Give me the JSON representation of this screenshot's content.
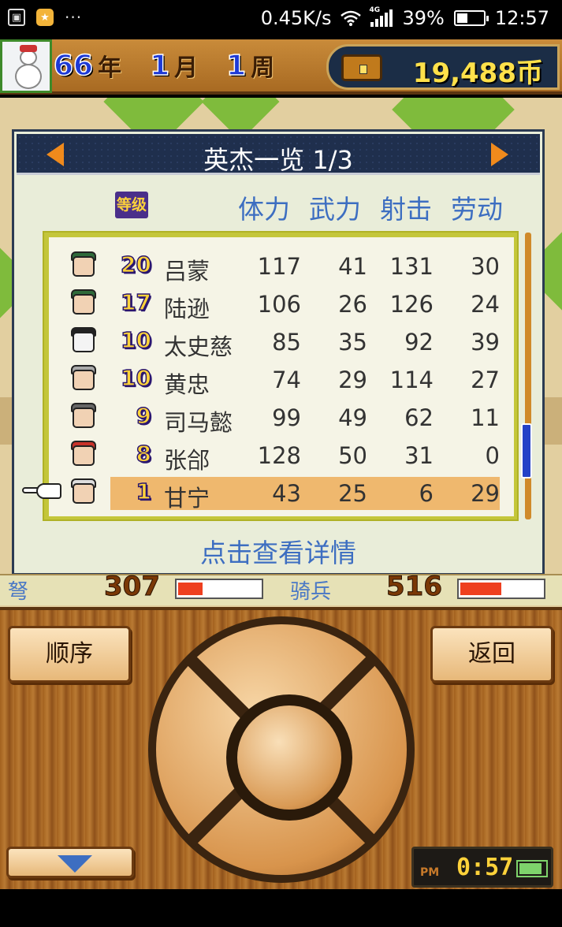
{
  "status_bar": {
    "network_speed": "0.45K/s",
    "network_type": "4G",
    "battery_percent": "39%",
    "time": "12:57",
    "icons": [
      "image-icon",
      "star-app-icon",
      "wifi-icon",
      "signal-icon",
      "battery-icon"
    ],
    "more": "···"
  },
  "game_header": {
    "year_num": "66",
    "year_unit": "年",
    "month_num": "1",
    "month_unit": "月",
    "week_num": "1",
    "week_unit": "周",
    "money": "19,488币"
  },
  "dialog": {
    "title": "英杰一览 1/3",
    "level_header": "等级",
    "columns": [
      "体力",
      "武力",
      "射击",
      "劳动"
    ],
    "rows": [
      {
        "level": "20",
        "name": "吕蒙",
        "stamina": "117",
        "force": "41",
        "shoot": "131",
        "labor": "30"
      },
      {
        "level": "17",
        "name": "陆逊",
        "stamina": "106",
        "force": "26",
        "shoot": "126",
        "labor": "24"
      },
      {
        "level": "10",
        "name": "太史慈",
        "stamina": "85",
        "force": "35",
        "shoot": "92",
        "labor": "39"
      },
      {
        "level": "10",
        "name": "黄忠",
        "stamina": "74",
        "force": "29",
        "shoot": "114",
        "labor": "27"
      },
      {
        "level": "9",
        "name": "司马懿",
        "stamina": "99",
        "force": "49",
        "shoot": "62",
        "labor": "11"
      },
      {
        "level": "8",
        "name": "张郃",
        "stamina": "128",
        "force": "50",
        "shoot": "31",
        "labor": "0"
      },
      {
        "level": "1",
        "name": "甘宁",
        "stamina": "43",
        "force": "25",
        "shoot": "6",
        "labor": "29"
      }
    ],
    "selected_index": 6,
    "detail_hint": "点击查看详情"
  },
  "strip": {
    "left_label": "弩",
    "left_value": "307",
    "left_fill_fraction": 0.3,
    "right_label": "骑兵",
    "right_value": "516",
    "right_fill_fraction": 0.5
  },
  "controller": {
    "order_label": "顺序",
    "back_label": "返回",
    "clock_ampm": "PM",
    "clock_time": "0:57"
  },
  "colors": {
    "accent_blue": "#3d6ec1",
    "header_navy": "#1f2f4d",
    "selected_row": "#efb86e",
    "level_gold": "#ffd33a"
  }
}
